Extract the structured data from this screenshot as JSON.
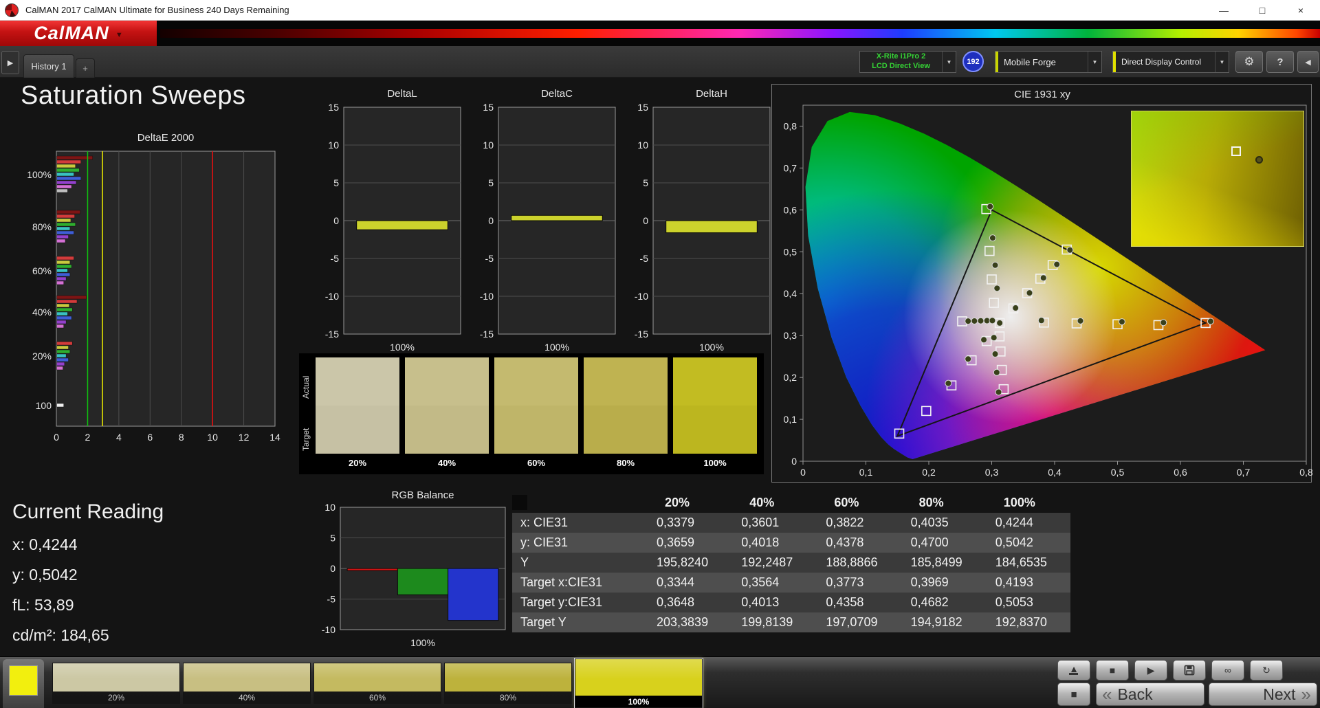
{
  "window": {
    "title": "CalMAN 2017 CalMAN Ultimate for Business 240 Days Remaining",
    "controls": {
      "minimize": "—",
      "maximize": "□",
      "close": "×"
    }
  },
  "brand": {
    "logo_text": "CalMAN",
    "dropdown_arrow": "▼"
  },
  "toolbar": {
    "expander": "▶",
    "history_tab": "History 1",
    "add_tab": "+",
    "meter": {
      "line1": "X-Rite i1Pro 2",
      "line2": "LCD Direct View"
    },
    "badge": "192",
    "workflow": "Mobile Forge",
    "display_control": "Direct Display Control",
    "gear": "⚙",
    "help": "?",
    "collapse": "◀",
    "dropdown_arrow": "▼"
  },
  "heading": "Saturation Sweeps",
  "current_reading": {
    "title": "Current Reading",
    "lines": [
      "x: 0,4244",
      "y: 0,5042",
      "fL: 53,89",
      "cd/m²: 184,65"
    ]
  },
  "swatch_panel": {
    "row_labels": [
      "Actual",
      "Target"
    ],
    "swatches": [
      {
        "label": "20%",
        "actual": "#cbc6a9",
        "target": "#c6c1a4"
      },
      {
        "label": "40%",
        "actual": "#c7bf8c",
        "target": "#c2ba87"
      },
      {
        "label": "60%",
        "actual": "#c4ba6f",
        "target": "#bfb569"
      },
      {
        "label": "80%",
        "actual": "#bfb351",
        "target": "#b9ad4b"
      },
      {
        "label": "100%",
        "actual": "#c2bc22",
        "target": "#bcb61f"
      }
    ]
  },
  "table": {
    "columns": [
      "20%",
      "40%",
      "60%",
      "80%",
      "100%"
    ],
    "rows": [
      {
        "label": "x: CIE31",
        "values": [
          "0,3379",
          "0,3601",
          "0,3822",
          "0,4035",
          "0,4244"
        ]
      },
      {
        "label": "y: CIE31",
        "values": [
          "0,3659",
          "0,4018",
          "0,4378",
          "0,4700",
          "0,5042"
        ]
      },
      {
        "label": "Y",
        "values": [
          "195,8240",
          "192,2487",
          "188,8866",
          "185,8499",
          "184,6535"
        ]
      },
      {
        "label": "Target x:CIE31",
        "values": [
          "0,3344",
          "0,3564",
          "0,3773",
          "0,3969",
          "0,4193"
        ]
      },
      {
        "label": "Target y:CIE31",
        "values": [
          "0,3648",
          "0,4013",
          "0,4358",
          "0,4682",
          "0,5053"
        ]
      },
      {
        "label": "Target Y",
        "values": [
          "203,3839",
          "199,8139",
          "197,0709",
          "194,9182",
          "192,8370"
        ]
      }
    ]
  },
  "bottom_bar": {
    "current_color": "#f2ef0e",
    "levels": [
      {
        "label": "20%",
        "color": "#ccc8a4",
        "selected": false
      },
      {
        "label": "40%",
        "color": "#c8bf82",
        "selected": false
      },
      {
        "label": "60%",
        "color": "#c4ba60",
        "selected": false
      },
      {
        "label": "80%",
        "color": "#bdb23c",
        "selected": false
      },
      {
        "label": "100%",
        "color": "#d8d11c",
        "selected": true
      }
    ],
    "icons": {
      "eject": "▲",
      "stop": "■",
      "play": "▶",
      "loop": "∞",
      "refresh": "↻",
      "stop_large": "■",
      "back_chevron": "«",
      "next_chevron": "»"
    },
    "back_label": "Back",
    "next_label": "Next"
  },
  "chart_data": [
    {
      "id": "deltae2000",
      "type": "bar",
      "title": "DeltaE 2000",
      "xlim": [
        0,
        14
      ],
      "xticks": [
        0,
        2,
        4,
        6,
        8,
        10,
        12,
        14
      ],
      "ref_lines": [
        {
          "x": 2,
          "color": "#10c010"
        },
        {
          "x": 2.95,
          "color": "#e6e600"
        },
        {
          "x": 10,
          "color": "#e01010"
        }
      ],
      "groups": [
        {
          "label": "100%",
          "pos": 0.085,
          "bars": [
            {
              "color": "#7d1414",
              "v": 2.3
            },
            {
              "color": "#d23b3b",
              "v": 1.55
            },
            {
              "color": "#c9c93e",
              "v": 1.2
            },
            {
              "color": "#2fae2f",
              "v": 1.45
            },
            {
              "color": "#39c2c2",
              "v": 1.1
            },
            {
              "color": "#3f5ed6",
              "v": 1.55
            },
            {
              "color": "#9340cc",
              "v": 1.25
            },
            {
              "color": "#d470d4",
              "v": 0.95
            },
            {
              "color": "#bfbfbf",
              "v": 0.7
            }
          ]
        },
        {
          "label": "80%",
          "pos": 0.275,
          "bars": [
            {
              "color": "#7d1414",
              "v": 1.5
            },
            {
              "color": "#d23b3b",
              "v": 1.15
            },
            {
              "color": "#c9c93e",
              "v": 0.9
            },
            {
              "color": "#2fae2f",
              "v": 1.2
            },
            {
              "color": "#39c2c2",
              "v": 0.85
            },
            {
              "color": "#3f5ed6",
              "v": 1.1
            },
            {
              "color": "#9340cc",
              "v": 0.75
            },
            {
              "color": "#d470d4",
              "v": 0.55
            }
          ]
        },
        {
          "label": "60%",
          "pos": 0.435,
          "bars": [
            {
              "color": "#d23b3b",
              "v": 1.1
            },
            {
              "color": "#c9c93e",
              "v": 0.85
            },
            {
              "color": "#2fae2f",
              "v": 0.95
            },
            {
              "color": "#39c2c2",
              "v": 0.7
            },
            {
              "color": "#3f5ed6",
              "v": 0.85
            },
            {
              "color": "#9340cc",
              "v": 0.6
            },
            {
              "color": "#d470d4",
              "v": 0.45
            }
          ]
        },
        {
          "label": "40%",
          "pos": 0.585,
          "bars": [
            {
              "color": "#7d1414",
              "v": 1.9
            },
            {
              "color": "#d23b3b",
              "v": 1.3
            },
            {
              "color": "#c9c93e",
              "v": 0.8
            },
            {
              "color": "#2fae2f",
              "v": 1.0
            },
            {
              "color": "#39c2c2",
              "v": 0.7
            },
            {
              "color": "#3f5ed6",
              "v": 0.95
            },
            {
              "color": "#9340cc",
              "v": 0.6
            },
            {
              "color": "#d470d4",
              "v": 0.45
            }
          ]
        },
        {
          "label": "20%",
          "pos": 0.745,
          "bars": [
            {
              "color": "#d23b3b",
              "v": 1.0
            },
            {
              "color": "#c9c93e",
              "v": 0.75
            },
            {
              "color": "#2fae2f",
              "v": 0.85
            },
            {
              "color": "#39c2c2",
              "v": 0.6
            },
            {
              "color": "#3f5ed6",
              "v": 0.75
            },
            {
              "color": "#9340cc",
              "v": 0.5
            },
            {
              "color": "#d470d4",
              "v": 0.4
            }
          ]
        },
        {
          "label": "100",
          "pos": 0.925,
          "bars": [
            {
              "color": "#f0f0f0",
              "v": 0.45
            }
          ]
        }
      ]
    },
    {
      "id": "deltal",
      "type": "bar",
      "title": "DeltaL",
      "ylim": [
        -15,
        15
      ],
      "yticks": [
        15,
        10,
        5,
        0,
        -5,
        -10,
        -15
      ],
      "category": "100%",
      "bars": [
        {
          "color": "#ccd22c",
          "v": -1.2
        }
      ]
    },
    {
      "id": "deltac",
      "type": "bar",
      "title": "DeltaC",
      "ylim": [
        -15,
        15
      ],
      "yticks": [
        15,
        10,
        5,
        0,
        -5,
        -10,
        -15
      ],
      "category": "100%",
      "bars": [
        {
          "color": "#ccd22c",
          "v": 0.7
        }
      ]
    },
    {
      "id": "deltah",
      "type": "bar",
      "title": "DeltaH",
      "ylim": [
        -15,
        15
      ],
      "yticks": [
        15,
        10,
        5,
        0,
        -5,
        -10,
        -15
      ],
      "category": "100%",
      "bars": [
        {
          "color": "#ccd22c",
          "v": -1.6
        }
      ]
    },
    {
      "id": "rgbbalance",
      "type": "bar",
      "title": "RGB Balance",
      "ylim": [
        -10,
        10
      ],
      "yticks": [
        10,
        5,
        0,
        -5,
        -10
      ],
      "category": "100%",
      "bars": [
        {
          "color": "#cc1414",
          "v": -0.35
        },
        {
          "color": "#1d8a1d",
          "v": -4.3
        },
        {
          "color": "#2334cc",
          "v": -8.5
        }
      ]
    },
    {
      "id": "cie1931",
      "type": "scatter",
      "title": "CIE 1931 xy",
      "xlim": [
        0,
        0.8
      ],
      "ylim": [
        0,
        0.85
      ],
      "xtick_labels": [
        "0",
        "0,1",
        "0,2",
        "0,3",
        "0,4",
        "0,5",
        "0,6",
        "0,7",
        "0,8"
      ],
      "ytick_labels": [
        "0",
        "0,1",
        "0,2",
        "0,3",
        "0,4",
        "0,5",
        "0,6",
        "0,7",
        "0,8"
      ],
      "gamut_triangle": [
        [
          0.64,
          0.33
        ],
        [
          0.3,
          0.6
        ],
        [
          0.15,
          0.06
        ]
      ],
      "squares": [
        [
          0.3344,
          0.3648
        ],
        [
          0.3564,
          0.4013
        ],
        [
          0.3773,
          0.4358
        ],
        [
          0.3969,
          0.4682
        ],
        [
          0.4193,
          0.5053
        ],
        [
          0.383,
          0.331
        ],
        [
          0.435,
          0.329
        ],
        [
          0.5,
          0.327
        ],
        [
          0.565,
          0.325
        ],
        [
          0.64,
          0.33
        ],
        [
          0.3035,
          0.378
        ],
        [
          0.3,
          0.434
        ],
        [
          0.2965,
          0.502
        ],
        [
          0.2915,
          0.602
        ],
        [
          0.292,
          0.287
        ],
        [
          0.268,
          0.241
        ],
        [
          0.236,
          0.181
        ],
        [
          0.196,
          0.12
        ],
        [
          0.153,
          0.066
        ],
        [
          0.3125,
          0.298
        ],
        [
          0.314,
          0.262
        ],
        [
          0.316,
          0.218
        ],
        [
          0.319,
          0.172
        ],
        [
          0.253,
          0.334
        ],
        [
          0.3127,
          0.33
        ]
      ],
      "circles": [
        [
          0.3379,
          0.3659
        ],
        [
          0.3601,
          0.4018
        ],
        [
          0.3822,
          0.4378
        ],
        [
          0.4035,
          0.47
        ],
        [
          0.4244,
          0.5042
        ],
        [
          0.379,
          0.336
        ],
        [
          0.441,
          0.335
        ],
        [
          0.507,
          0.333
        ],
        [
          0.573,
          0.331
        ],
        [
          0.648,
          0.334
        ],
        [
          0.3085,
          0.413
        ],
        [
          0.3055,
          0.468
        ],
        [
          0.3015,
          0.533
        ],
        [
          0.2975,
          0.608
        ],
        [
          0.2875,
          0.29
        ],
        [
          0.2625,
          0.244
        ],
        [
          0.231,
          0.186
        ],
        [
          0.3035,
          0.295
        ],
        [
          0.3055,
          0.256
        ],
        [
          0.308,
          0.212
        ],
        [
          0.311,
          0.165
        ],
        [
          0.2625,
          0.3345
        ],
        [
          0.2725,
          0.3348
        ],
        [
          0.2825,
          0.3352
        ],
        [
          0.2925,
          0.3355
        ],
        [
          0.301,
          0.3358
        ],
        [
          0.3127,
          0.33
        ]
      ],
      "inset": {
        "squares": [
          [
            0.58,
            0.26
          ]
        ],
        "circles": [
          [
            0.72,
            0.33
          ]
        ]
      }
    }
  ]
}
